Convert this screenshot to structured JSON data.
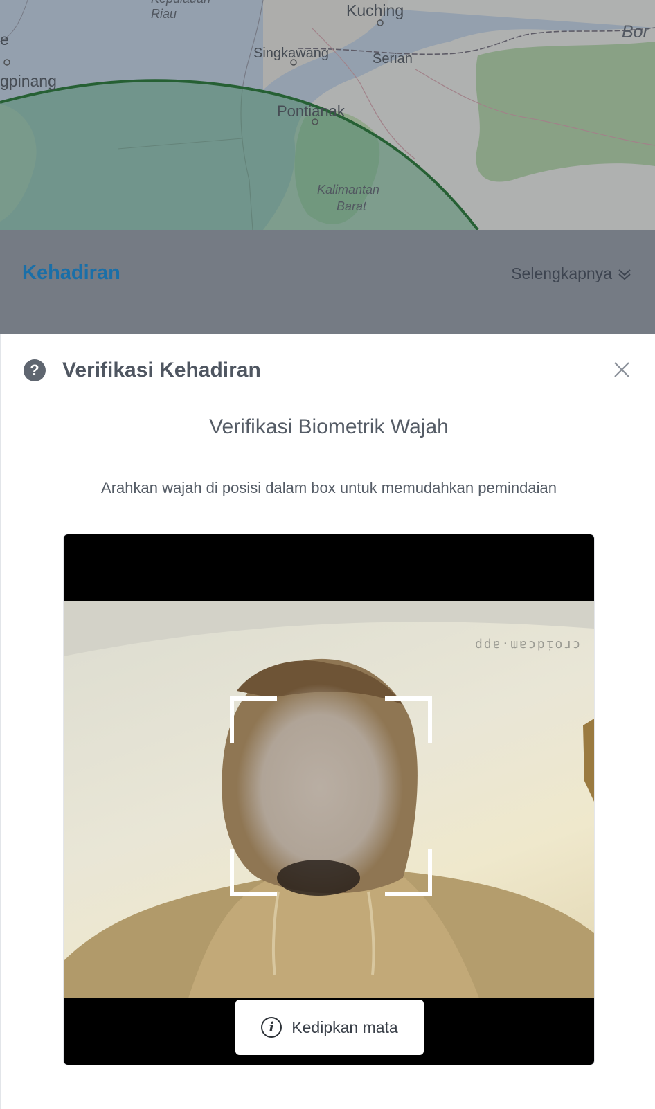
{
  "map": {
    "labels": {
      "riau": "Riau",
      "riau_top": "Kepulauan",
      "kuching": "Kuching",
      "bor": "Bor",
      "singkawang": "Singkawang",
      "serian": "Serian",
      "pangkalpinang": "gpinang",
      "pontianak": "Pontianak",
      "kalbar_1": "Kalimantan",
      "kalbar_2": "Barat",
      "left_edge": "e"
    }
  },
  "section": {
    "title": "Kehadiran",
    "more_label": "Selengkapnya"
  },
  "modal": {
    "title": "Verifikasi Kehadiran",
    "subtitle": "Verifikasi Biometrik Wajah",
    "instruction": "Arahkan wajah di posisi dalam box untuk memudahkan pemindaian",
    "camera_watermark": "ddɐ·ɯɐɔpᴉoɹɔ",
    "prompt_label": "Kedipkan mata"
  },
  "icons": {
    "help": "question-circle-icon",
    "close": "close-icon",
    "chevron": "double-chevron-down-icon",
    "info": "info-circle-icon"
  },
  "colors": {
    "accent": "#1a6fa8",
    "geofence_stroke": "#1e6b2a",
    "geofence_fill": "#5ea77e"
  }
}
